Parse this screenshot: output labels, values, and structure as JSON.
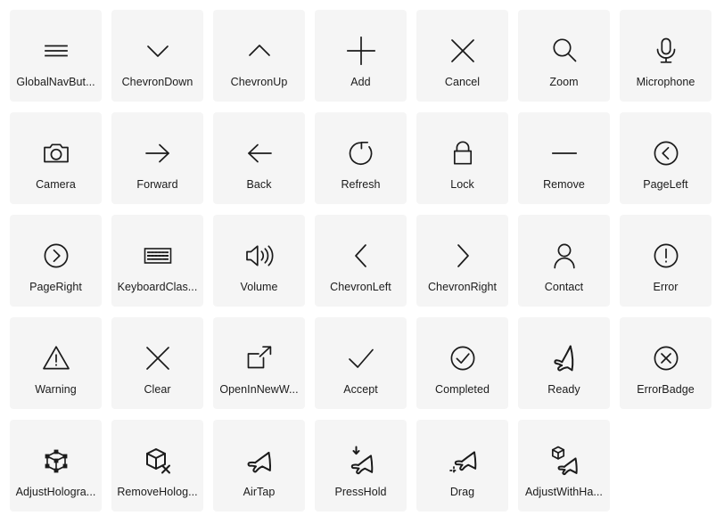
{
  "page": {
    "background": "#ffffff",
    "card_background": "#f5f5f5",
    "icon_color": "#1b1b1b",
    "label_color": "#1b1b1b",
    "columns": 7,
    "rows": 5
  },
  "icons": [
    {
      "label": "GlobalNavBut...",
      "full_label": "GlobalNavButton",
      "glyph": "hamburger-menu-icon"
    },
    {
      "label": "ChevronDown",
      "full_label": "ChevronDown",
      "glyph": "chevron-down-icon"
    },
    {
      "label": "ChevronUp",
      "full_label": "ChevronUp",
      "glyph": "chevron-up-icon"
    },
    {
      "label": "Add",
      "full_label": "Add",
      "glyph": "plus-icon"
    },
    {
      "label": "Cancel",
      "full_label": "Cancel",
      "glyph": "x-cross-icon"
    },
    {
      "label": "Zoom",
      "full_label": "Zoom",
      "glyph": "magnifier-icon"
    },
    {
      "label": "Microphone",
      "full_label": "Microphone",
      "glyph": "microphone-icon"
    },
    {
      "label": "Camera",
      "full_label": "Camera",
      "glyph": "camera-icon"
    },
    {
      "label": "Forward",
      "full_label": "Forward",
      "glyph": "arrow-right-icon"
    },
    {
      "label": "Back",
      "full_label": "Back",
      "glyph": "arrow-left-icon"
    },
    {
      "label": "Refresh",
      "full_label": "Refresh",
      "glyph": "refresh-circular-arrow-icon"
    },
    {
      "label": "Lock",
      "full_label": "Lock",
      "glyph": "padlock-icon"
    },
    {
      "label": "Remove",
      "full_label": "Remove",
      "glyph": "minus-icon"
    },
    {
      "label": "PageLeft",
      "full_label": "PageLeft",
      "glyph": "circled-chevron-left-icon"
    },
    {
      "label": "PageRight",
      "full_label": "PageRight",
      "glyph": "circled-chevron-right-icon"
    },
    {
      "label": "KeyboardClas...",
      "full_label": "KeyboardClassic",
      "glyph": "keyboard-icon"
    },
    {
      "label": "Volume",
      "full_label": "Volume",
      "glyph": "speaker-volume-icon"
    },
    {
      "label": "ChevronLeft",
      "full_label": "ChevronLeft",
      "glyph": "chevron-left-icon"
    },
    {
      "label": "ChevronRight",
      "full_label": "ChevronRight",
      "glyph": "chevron-right-icon"
    },
    {
      "label": "Contact",
      "full_label": "Contact",
      "glyph": "person-contact-icon"
    },
    {
      "label": "Error",
      "full_label": "Error",
      "glyph": "circled-exclamation-icon"
    },
    {
      "label": "Warning",
      "full_label": "Warning",
      "glyph": "warning-triangle-icon"
    },
    {
      "label": "Clear",
      "full_label": "Clear",
      "glyph": "x-cross-icon"
    },
    {
      "label": "OpenInNewW...",
      "full_label": "OpenInNewWindow",
      "glyph": "open-in-new-window-icon"
    },
    {
      "label": "Accept",
      "full_label": "Accept",
      "glyph": "checkmark-icon"
    },
    {
      "label": "Completed",
      "full_label": "Completed",
      "glyph": "circled-checkmark-icon"
    },
    {
      "label": "Ready",
      "full_label": "Ready",
      "glyph": "hand-ready-gesture-icon"
    },
    {
      "label": "ErrorBadge",
      "full_label": "ErrorBadge",
      "glyph": "circled-x-icon"
    },
    {
      "label": "AdjustHologra...",
      "full_label": "AdjustHologram",
      "glyph": "adjust-hologram-cube-icon"
    },
    {
      "label": "RemoveHolog...",
      "full_label": "RemoveHologram",
      "glyph": "remove-hologram-cube-icon"
    },
    {
      "label": "AirTap",
      "full_label": "AirTap",
      "glyph": "hand-airtap-icon"
    },
    {
      "label": "PressHold",
      "full_label": "PressHold",
      "glyph": "hand-press-hold-icon"
    },
    {
      "label": "Drag",
      "full_label": "Drag",
      "glyph": "hand-drag-icon"
    },
    {
      "label": "AdjustWithHa...",
      "full_label": "AdjustWithHand",
      "glyph": "adjust-with-hand-icon"
    }
  ]
}
